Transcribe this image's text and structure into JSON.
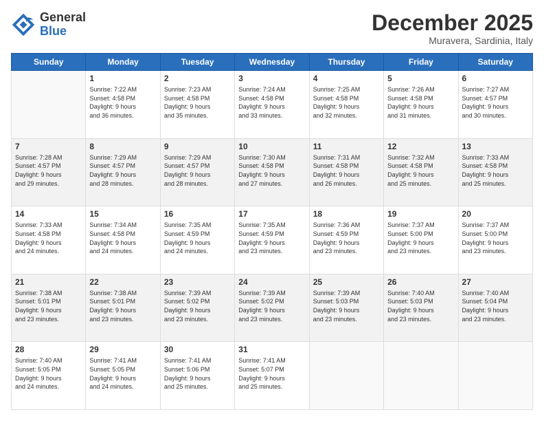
{
  "logo": {
    "general": "General",
    "blue": "Blue"
  },
  "title": "December 2025",
  "location": "Muravera, Sardinia, Italy",
  "days_header": [
    "Sunday",
    "Monday",
    "Tuesday",
    "Wednesday",
    "Thursday",
    "Friday",
    "Saturday"
  ],
  "weeks": [
    [
      {
        "day": "",
        "info": ""
      },
      {
        "day": "1",
        "info": "Sunrise: 7:22 AM\nSunset: 4:58 PM\nDaylight: 9 hours\nand 36 minutes."
      },
      {
        "day": "2",
        "info": "Sunrise: 7:23 AM\nSunset: 4:58 PM\nDaylight: 9 hours\nand 35 minutes."
      },
      {
        "day": "3",
        "info": "Sunrise: 7:24 AM\nSunset: 4:58 PM\nDaylight: 9 hours\nand 33 minutes."
      },
      {
        "day": "4",
        "info": "Sunrise: 7:25 AM\nSunset: 4:58 PM\nDaylight: 9 hours\nand 32 minutes."
      },
      {
        "day": "5",
        "info": "Sunrise: 7:26 AM\nSunset: 4:58 PM\nDaylight: 9 hours\nand 31 minutes."
      },
      {
        "day": "6",
        "info": "Sunrise: 7:27 AM\nSunset: 4:57 PM\nDaylight: 9 hours\nand 30 minutes."
      }
    ],
    [
      {
        "day": "7",
        "info": "Sunrise: 7:28 AM\nSunset: 4:57 PM\nDaylight: 9 hours\nand 29 minutes."
      },
      {
        "day": "8",
        "info": "Sunrise: 7:29 AM\nSunset: 4:57 PM\nDaylight: 9 hours\nand 28 minutes."
      },
      {
        "day": "9",
        "info": "Sunrise: 7:29 AM\nSunset: 4:57 PM\nDaylight: 9 hours\nand 28 minutes."
      },
      {
        "day": "10",
        "info": "Sunrise: 7:30 AM\nSunset: 4:58 PM\nDaylight: 9 hours\nand 27 minutes."
      },
      {
        "day": "11",
        "info": "Sunrise: 7:31 AM\nSunset: 4:58 PM\nDaylight: 9 hours\nand 26 minutes."
      },
      {
        "day": "12",
        "info": "Sunrise: 7:32 AM\nSunset: 4:58 PM\nDaylight: 9 hours\nand 25 minutes."
      },
      {
        "day": "13",
        "info": "Sunrise: 7:33 AM\nSunset: 4:58 PM\nDaylight: 9 hours\nand 25 minutes."
      }
    ],
    [
      {
        "day": "14",
        "info": "Sunrise: 7:33 AM\nSunset: 4:58 PM\nDaylight: 9 hours\nand 24 minutes."
      },
      {
        "day": "15",
        "info": "Sunrise: 7:34 AM\nSunset: 4:58 PM\nDaylight: 9 hours\nand 24 minutes."
      },
      {
        "day": "16",
        "info": "Sunrise: 7:35 AM\nSunset: 4:59 PM\nDaylight: 9 hours\nand 24 minutes."
      },
      {
        "day": "17",
        "info": "Sunrise: 7:35 AM\nSunset: 4:59 PM\nDaylight: 9 hours\nand 23 minutes."
      },
      {
        "day": "18",
        "info": "Sunrise: 7:36 AM\nSunset: 4:59 PM\nDaylight: 9 hours\nand 23 minutes."
      },
      {
        "day": "19",
        "info": "Sunrise: 7:37 AM\nSunset: 5:00 PM\nDaylight: 9 hours\nand 23 minutes."
      },
      {
        "day": "20",
        "info": "Sunrise: 7:37 AM\nSunset: 5:00 PM\nDaylight: 9 hours\nand 23 minutes."
      }
    ],
    [
      {
        "day": "21",
        "info": "Sunrise: 7:38 AM\nSunset: 5:01 PM\nDaylight: 9 hours\nand 23 minutes."
      },
      {
        "day": "22",
        "info": "Sunrise: 7:38 AM\nSunset: 5:01 PM\nDaylight: 9 hours\nand 23 minutes."
      },
      {
        "day": "23",
        "info": "Sunrise: 7:39 AM\nSunset: 5:02 PM\nDaylight: 9 hours\nand 23 minutes."
      },
      {
        "day": "24",
        "info": "Sunrise: 7:39 AM\nSunset: 5:02 PM\nDaylight: 9 hours\nand 23 minutes."
      },
      {
        "day": "25",
        "info": "Sunrise: 7:39 AM\nSunset: 5:03 PM\nDaylight: 9 hours\nand 23 minutes."
      },
      {
        "day": "26",
        "info": "Sunrise: 7:40 AM\nSunset: 5:03 PM\nDaylight: 9 hours\nand 23 minutes."
      },
      {
        "day": "27",
        "info": "Sunrise: 7:40 AM\nSunset: 5:04 PM\nDaylight: 9 hours\nand 23 minutes."
      }
    ],
    [
      {
        "day": "28",
        "info": "Sunrise: 7:40 AM\nSunset: 5:05 PM\nDaylight: 9 hours\nand 24 minutes."
      },
      {
        "day": "29",
        "info": "Sunrise: 7:41 AM\nSunset: 5:05 PM\nDaylight: 9 hours\nand 24 minutes."
      },
      {
        "day": "30",
        "info": "Sunrise: 7:41 AM\nSunset: 5:06 PM\nDaylight: 9 hours\nand 25 minutes."
      },
      {
        "day": "31",
        "info": "Sunrise: 7:41 AM\nSunset: 5:07 PM\nDaylight: 9 hours\nand 25 minutes."
      },
      {
        "day": "",
        "info": ""
      },
      {
        "day": "",
        "info": ""
      },
      {
        "day": "",
        "info": ""
      }
    ]
  ]
}
